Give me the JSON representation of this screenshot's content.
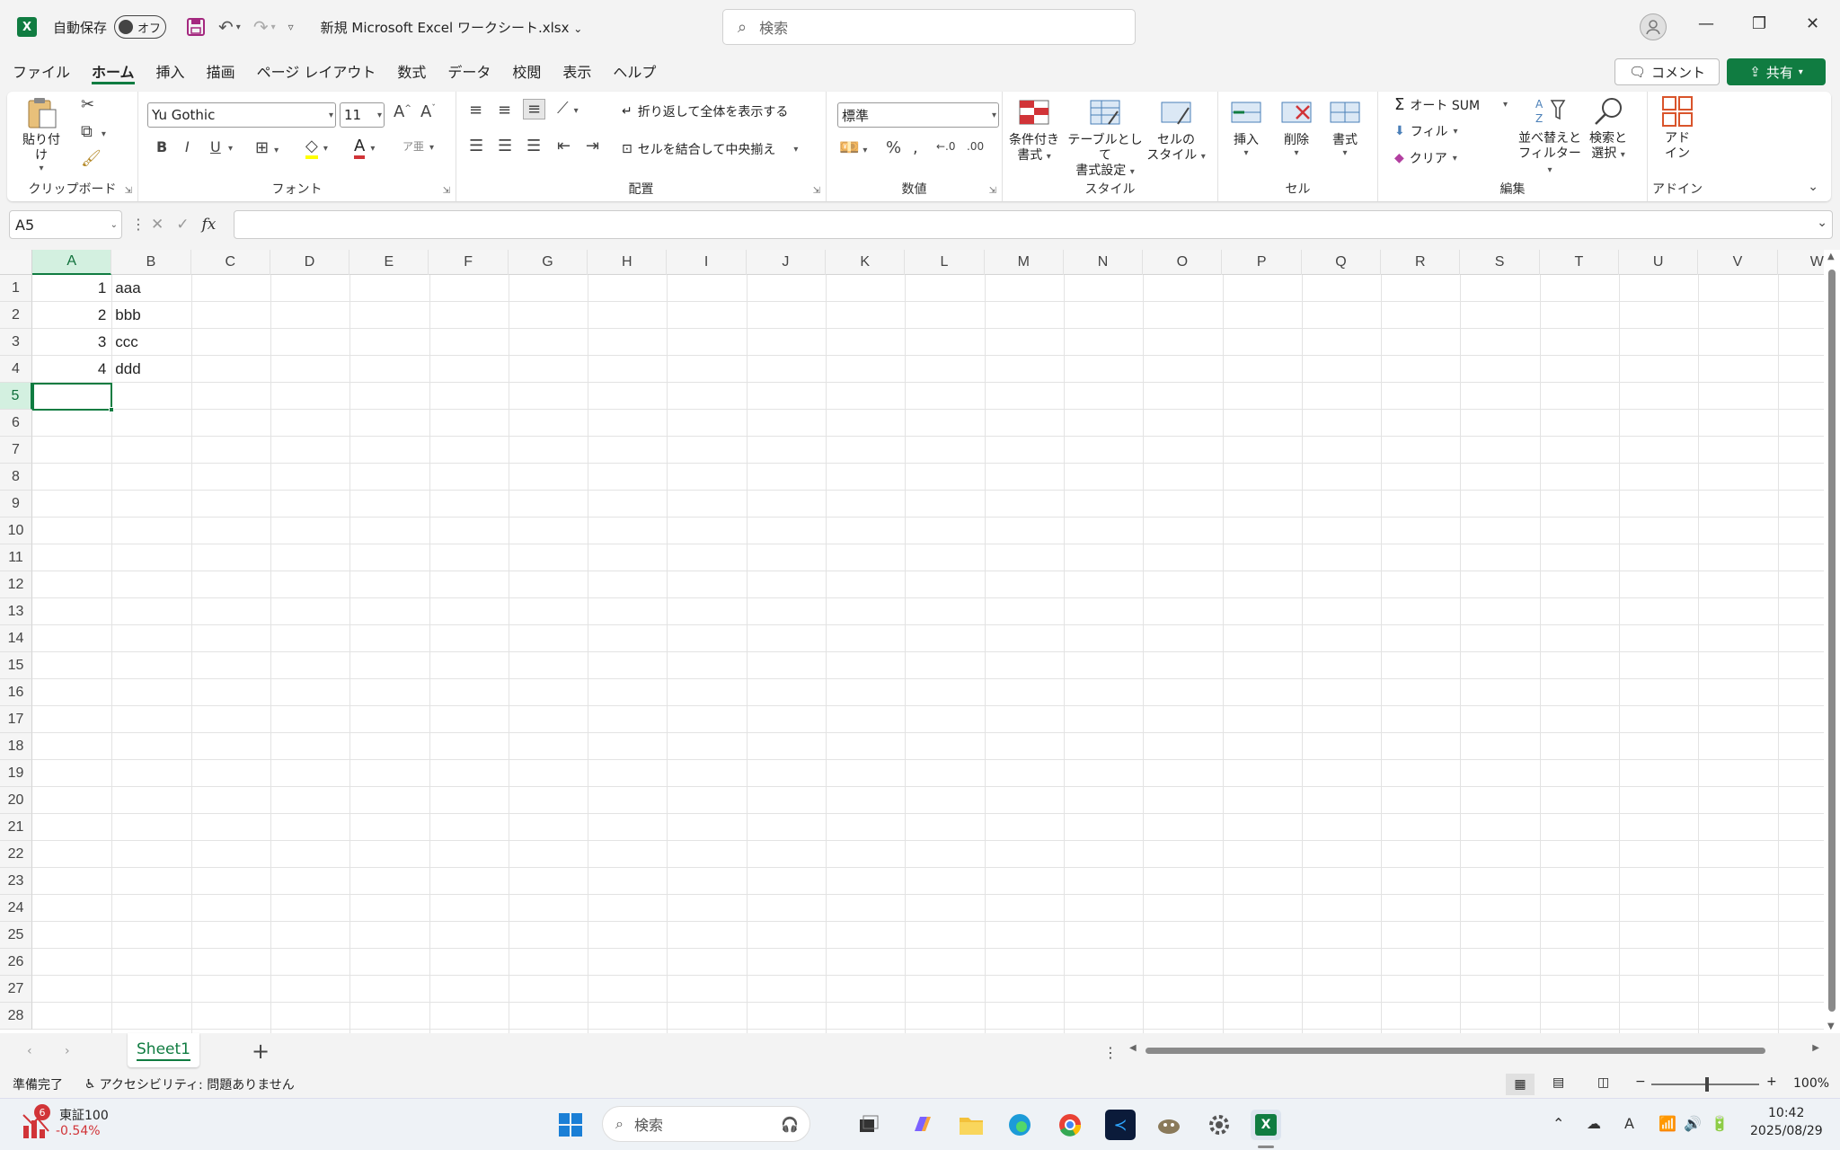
{
  "titlebar": {
    "app_logo": "X",
    "autosave_label": "自動保存",
    "autosave_state": "オフ",
    "doc_title": "新規 Microsoft Excel ワークシート.xlsx",
    "search_placeholder": "検索"
  },
  "ribbon_tabs": [
    "ファイル",
    "ホーム",
    "挿入",
    "描画",
    "ページ レイアウト",
    "数式",
    "データ",
    "校閲",
    "表示",
    "ヘルプ"
  ],
  "comment_label": "コメント",
  "share_label": "共有",
  "ribbon": {
    "clipboard": {
      "paste": "貼り付け",
      "label": "クリップボード"
    },
    "font": {
      "name": "Yu Gothic",
      "size": "11",
      "label": "フォント",
      "bold": "B",
      "italic": "I",
      "underline": "U"
    },
    "alignment": {
      "wrap": "折り返して全体を表示する",
      "merge": "セルを結合して中央揃え",
      "label": "配置"
    },
    "number": {
      "format": "標準",
      "label": "数値"
    },
    "styles": {
      "cond": "条件付き書式",
      "table": "テーブルとして書式設定",
      "cell": "セルのスタイル",
      "label": "スタイル",
      "cond_l1": "条件付き",
      "cond_l2": "書式",
      "table_l1": "テーブルとして",
      "table_l2": "書式設定",
      "cell_l1": "セルの",
      "cell_l2": "スタイル"
    },
    "cells": {
      "insert": "挿入",
      "delete": "削除",
      "format": "書式",
      "label": "セル"
    },
    "editing": {
      "autosum": "オート SUM",
      "fill": "フィル",
      "clear": "クリア",
      "sort_l1": "並べ替えと",
      "sort_l2": "フィルター",
      "find_l1": "検索と",
      "find_l2": "選択",
      "label": "編集"
    },
    "addin": {
      "l1": "アド",
      "l2": "イン",
      "label": "アドイン"
    }
  },
  "namebox": "A5",
  "columns": [
    "A",
    "B",
    "C",
    "D",
    "E",
    "F",
    "G",
    "H",
    "I",
    "J",
    "K",
    "L",
    "M",
    "N",
    "O",
    "P",
    "Q",
    "R",
    "S",
    "T",
    "U",
    "V",
    "W"
  ],
  "rows": [
    "1",
    "2",
    "3",
    "4",
    "5",
    "6",
    "7",
    "8",
    "9",
    "10",
    "11",
    "12",
    "13",
    "14",
    "15",
    "16",
    "17",
    "18",
    "19",
    "20",
    "21",
    "22",
    "23",
    "24",
    "25",
    "26",
    "27",
    "28"
  ],
  "cells": {
    "a": [
      "1",
      "2",
      "3",
      "4"
    ],
    "b": [
      "aaa",
      "bbb",
      "ccc",
      "ddd"
    ]
  },
  "sheet_tab": "Sheet1",
  "statusbar": {
    "ready": "準備完了",
    "accessibility": "アクセシビリティ: 問題ありません",
    "zoom": "100%"
  },
  "taskbar": {
    "stock_name": "東証100",
    "stock_change": "-0.54%",
    "stock_badge": "6",
    "search": "検索",
    "time": "10:42",
    "date": "2025/08/29"
  },
  "colors": {
    "accent": "#107c41",
    "negative": "#d13438"
  }
}
